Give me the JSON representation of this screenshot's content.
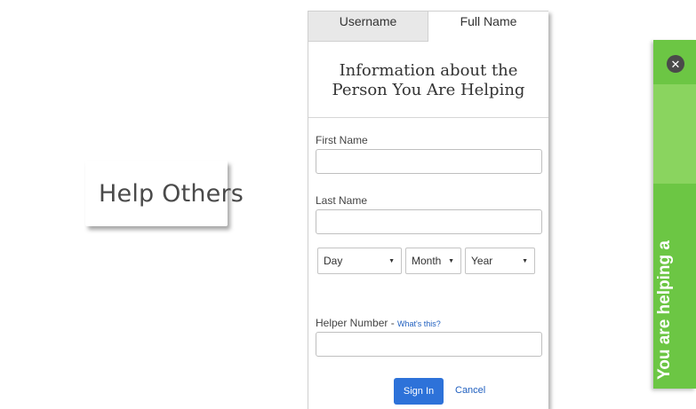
{
  "help_button": {
    "label": "Help Others",
    "icon": "lifebuoy-icon"
  },
  "panel": {
    "tabs": [
      {
        "label": "Username",
        "active": false
      },
      {
        "label": "Full Name",
        "active": true
      }
    ],
    "title_line1": "Information about the",
    "title_line2": "Person You Are Helping",
    "first_name": {
      "label": "First Name",
      "value": ""
    },
    "last_name": {
      "label": "Last Name",
      "value": ""
    },
    "dob": {
      "day": "Day",
      "month": "Month",
      "year": "Year"
    },
    "helper_number": {
      "label": "Helper Number - ",
      "link": "What's this?",
      "value": ""
    },
    "signin_label": "Sign In",
    "cancel_label": "Cancel"
  },
  "green_bar": {
    "text": "You are helping a",
    "close_icon": "close-icon",
    "color": "#6cc644"
  }
}
